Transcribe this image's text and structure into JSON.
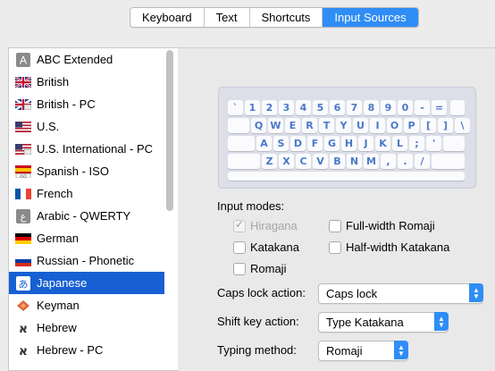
{
  "tabs": [
    {
      "label": "Keyboard"
    },
    {
      "label": "Text"
    },
    {
      "label": "Shortcuts"
    },
    {
      "label": "Input Sources",
      "selected": true
    }
  ],
  "sources": [
    {
      "label": "ABC Extended",
      "icon": "letter-a-icon"
    },
    {
      "label": "British",
      "icon": "uk-flag-icon"
    },
    {
      "label": "British - PC",
      "icon": "uk-flag-pc-icon"
    },
    {
      "label": "U.S.",
      "icon": "us-flag-icon"
    },
    {
      "label": "U.S. International - PC",
      "icon": "us-flag-pc-icon"
    },
    {
      "label": "Spanish - ISO",
      "icon": "spain-flag-iso-icon"
    },
    {
      "label": "French",
      "icon": "france-flag-icon"
    },
    {
      "label": "Arabic - QWERTY",
      "icon": "arabic-letter-icon"
    },
    {
      "label": "German",
      "icon": "germany-flag-icon"
    },
    {
      "label": "Russian - Phonetic",
      "icon": "russia-flag-icon"
    },
    {
      "label": "Japanese",
      "icon": "hiragana-a-icon",
      "selected": true
    },
    {
      "label": "Keyman",
      "icon": "keyman-icon"
    },
    {
      "label": "Hebrew",
      "icon": "hebrew-letter-icon"
    },
    {
      "label": "Hebrew - PC",
      "icon": "hebrew-letter-pc-icon"
    }
  ],
  "keyboard_rows": [
    [
      "`",
      "1",
      "2",
      "3",
      "4",
      "5",
      "6",
      "7",
      "8",
      "9",
      "0",
      "-",
      "="
    ],
    [
      "Q",
      "W",
      "E",
      "R",
      "T",
      "Y",
      "U",
      "I",
      "O",
      "P",
      "[",
      "]",
      "\\"
    ],
    [
      "A",
      "S",
      "D",
      "F",
      "G",
      "H",
      "J",
      "K",
      "L",
      ";",
      "'"
    ],
    [
      "Z",
      "X",
      "C",
      "V",
      "B",
      "N",
      "M",
      ",",
      ".",
      "/"
    ]
  ],
  "input_modes": {
    "title": "Input modes:",
    "hiragana": {
      "label": "Hiragana",
      "checked": true,
      "disabled": true
    },
    "katakana": {
      "label": "Katakana",
      "checked": false
    },
    "romaji": {
      "label": "Romaji",
      "checked": false
    },
    "full_width_romaji": {
      "label": "Full-width Romaji",
      "checked": false
    },
    "half_width_katakana": {
      "label": "Half-width Katakana",
      "checked": false
    }
  },
  "caps_lock": {
    "label": "Caps lock action:",
    "value": "Caps lock"
  },
  "shift_key": {
    "label": "Shift key action:",
    "value": "Type Katakana"
  },
  "typing_method": {
    "label": "Typing method:",
    "value": "Romaji"
  },
  "colors": {
    "accent": "#2f8df5",
    "selection": "#1760d3",
    "key_text": "#4a78c9"
  }
}
